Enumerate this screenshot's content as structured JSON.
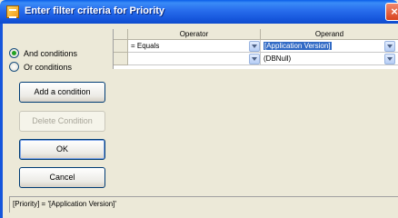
{
  "window": {
    "title": "Enter filter criteria for Priority",
    "close_glyph": "×"
  },
  "conditions": {
    "and_label": "And conditions",
    "or_label": "Or conditions",
    "selected": "and"
  },
  "buttons": {
    "add_condition": "Add a condition",
    "delete_condition": "Delete Condition",
    "ok": "OK",
    "cancel": "Cancel"
  },
  "grid": {
    "columns": [
      "Operator",
      "Operand"
    ],
    "rows": [
      {
        "operator": "= Equals",
        "operand": "[Application Version]",
        "operand_selected": true
      },
      {
        "operator": "",
        "operand": "(DBNull)",
        "operand_selected": false
      }
    ]
  },
  "status": {
    "expression": "[Priority] = '[Application Version]'"
  },
  "icons": {
    "title": "filter-window-icon",
    "close": "close-icon",
    "dropdown": "chevron-down-icon"
  },
  "colors": {
    "title_bar": "#2a70ee",
    "selection": "#316ac5",
    "radio_dot": "#21a121",
    "close_button": "#d8421c"
  }
}
